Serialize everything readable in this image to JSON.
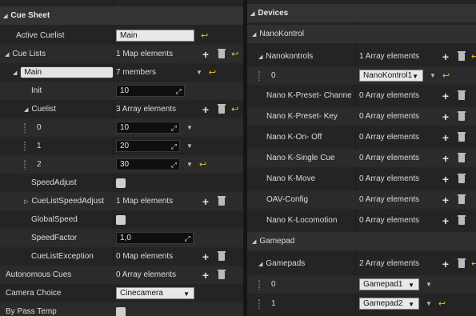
{
  "left": {
    "title": "Cue Sheet",
    "rows": {
      "active_cuelist": {
        "label": "Active Cuelist",
        "value": "Main"
      },
      "cue_lists": {
        "label": "Cue Lists",
        "value": "1 Map elements"
      },
      "main": {
        "key": "Main",
        "value": "7 members"
      },
      "init": {
        "label": "Init",
        "value": "10"
      },
      "cuelist": {
        "label": "Cuelist",
        "value": "3 Array elements"
      },
      "items": [
        {
          "index": "0",
          "value": "10"
        },
        {
          "index": "1",
          "value": "20"
        },
        {
          "index": "2",
          "value": "30"
        }
      ],
      "speed_adjust": {
        "label": "SpeedAdjust"
      },
      "cuelist_speed_adjust": {
        "label": "CueListSpeedAdjust",
        "value": "1 Map elements"
      },
      "global_speed": {
        "label": "GlobalSpeed"
      },
      "speed_factor": {
        "label": "SpeedFactor",
        "value": "1,0"
      },
      "cuelist_exception": {
        "label": "CueListException",
        "value": "0 Map elements"
      },
      "autonomous_cues": {
        "label": "Autonomous Cues",
        "value": "0 Array elements"
      },
      "camera_choice": {
        "label": "Camera Choice",
        "value": "Cinecamera"
      },
      "by_pass_temp": {
        "label": "By Pass Temp"
      }
    }
  },
  "right": {
    "title": "Devices",
    "nanokontrol_section": "NanoKontrol",
    "nanokontrols": {
      "label": "Nanokontrols",
      "value": "1 Array elements"
    },
    "nanokontrol_item": {
      "index": "0",
      "value": "NanoKontrol1"
    },
    "arrays": [
      {
        "label": "Nano K-Preset- Channe",
        "value": "0 Array elements"
      },
      {
        "label": "Nano K-Preset- Key",
        "value": "0 Array elements"
      },
      {
        "label": "Nano K-On- Off",
        "value": "0 Array elements"
      },
      {
        "label": "Nano K-Single Cue",
        "value": "0 Array elements"
      },
      {
        "label": "Nano K-Move",
        "value": "0 Array elements"
      },
      {
        "label": "OAV-Config",
        "value": "0 Array elements"
      },
      {
        "label": "Nano K-Locomotion",
        "value": "0 Array elements"
      }
    ],
    "gamepad_section": "Gamepad",
    "gamepads": {
      "label": "Gamepads",
      "value": "2 Array elements"
    },
    "gamepad_items": [
      {
        "index": "0",
        "value": "Gamepad1"
      },
      {
        "index": "1",
        "value": "Gamepad2"
      }
    ]
  },
  "icons": {
    "expand": "triangle-down-icon",
    "collapse": "triangle-right-icon",
    "add": "plus-icon",
    "delete": "trash-icon",
    "reset": "reset-arrow-icon"
  },
  "colors": {
    "reset_yellow": "#e0c020",
    "panel_bg": "#242424",
    "header_bg": "#333333"
  }
}
